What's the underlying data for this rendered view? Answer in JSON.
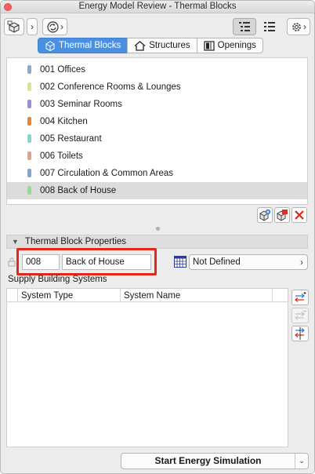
{
  "window": {
    "title": "Energy Model Review - Thermal Blocks"
  },
  "toolbar": {
    "left_icons": [
      "model-cube-icon",
      "refresh-icon"
    ],
    "right_icons": [
      "tree-list-icon",
      "flat-list-icon",
      "settings-gear-icon"
    ],
    "chevron": "›"
  },
  "tabs": [
    {
      "label": "Thermal Blocks",
      "icon": "thermal-block-icon",
      "selected": true
    },
    {
      "label": "Structures",
      "icon": "house-icon",
      "selected": false
    },
    {
      "label": "Openings",
      "icon": "door-icon",
      "selected": false
    }
  ],
  "thermal_blocks": [
    {
      "label": "001 Offices",
      "color": "#8aa9d4"
    },
    {
      "label": "002 Conference Rooms & Lounges",
      "color": "#e6df8e"
    },
    {
      "label": "003 Seminar Rooms",
      "color": "#9c8ed8"
    },
    {
      "label": "004 Kitchen",
      "color": "#e08a2a"
    },
    {
      "label": "005 Restaurant",
      "color": "#7fd8d8"
    },
    {
      "label": "006 Toilets",
      "color": "#e4a08e"
    },
    {
      "label": "007 Circulation & Common Areas",
      "color": "#7fa6d4"
    },
    {
      "label": "008 Back of House",
      "color": "#8ee08e",
      "selected": true
    }
  ],
  "list_actions": [
    "add-block-icon",
    "merge-block-icon",
    "delete-icon"
  ],
  "properties": {
    "header": "Thermal Block Properties",
    "id_value": "008",
    "name_value": "Back of House",
    "profile_value": "Not Defined",
    "profile_chevron": "›"
  },
  "supply": {
    "label": "Supply Building Systems",
    "columns": [
      "System Type",
      "System Name"
    ]
  },
  "side_actions": [
    "add-system-icon",
    "remove-system-icon",
    "assign-system-icon"
  ],
  "footer": {
    "start_label": "Start Energy Simulation",
    "dropdown_glyph": "⌄"
  }
}
